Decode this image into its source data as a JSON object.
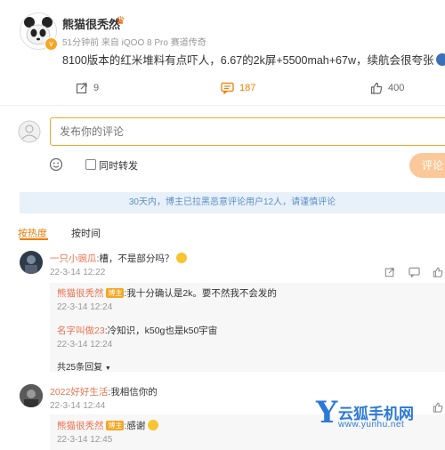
{
  "post": {
    "author": "熊猫很秃然",
    "meta": "51分钟前 来自 iQOO 8 Pro 赛道传奇",
    "text": "8100版本的红米堆料有点吓人，6.67的2k屏+5500mah+67w，续航会很夸张",
    "actions": {
      "repost_count": "9",
      "comment_count": "187",
      "like_count": "400"
    }
  },
  "compose": {
    "placeholder": "发布你的评论",
    "repost_label": "同时转发",
    "submit_label": "评论"
  },
  "notice": "30天内，博主已拉黑恶意评论用户12人，请谨慎评论",
  "sort": {
    "hot": "按热度",
    "time": "按时间"
  },
  "comments": [
    {
      "user": "一只小豌瓜",
      "text": ":槽，不是部分吗？",
      "time": "22-3-14 12:22",
      "replies": [
        {
          "user": "熊猫很秃然",
          "badge": "博主",
          "text": ":我十分确认是2k。要不然我不会发的",
          "time": "22-3-14 12:24"
        },
        {
          "user": "名字叫做23",
          "text": ":冷知识，k50g也是k50宇宙",
          "time": "22-3-14 12:24"
        }
      ],
      "more": "共25条回复"
    },
    {
      "user": "2022好好生活",
      "text": ":我相信你的",
      "time": "22-3-14 12:44",
      "replies": [
        {
          "user": "熊猫很秃然",
          "badge": "博主",
          "text": ":感谢",
          "time": "22-3-14 12:45"
        }
      ]
    }
  ],
  "watermark": {
    "logo_letter": "Y",
    "name": "云狐手机网",
    "url": "www.yunhu.net"
  },
  "colors": {
    "accent": "#f07c00",
    "link": "#eb7350",
    "notice_bg": "#e8f1f9",
    "notice_text": "#5b8fc7"
  }
}
